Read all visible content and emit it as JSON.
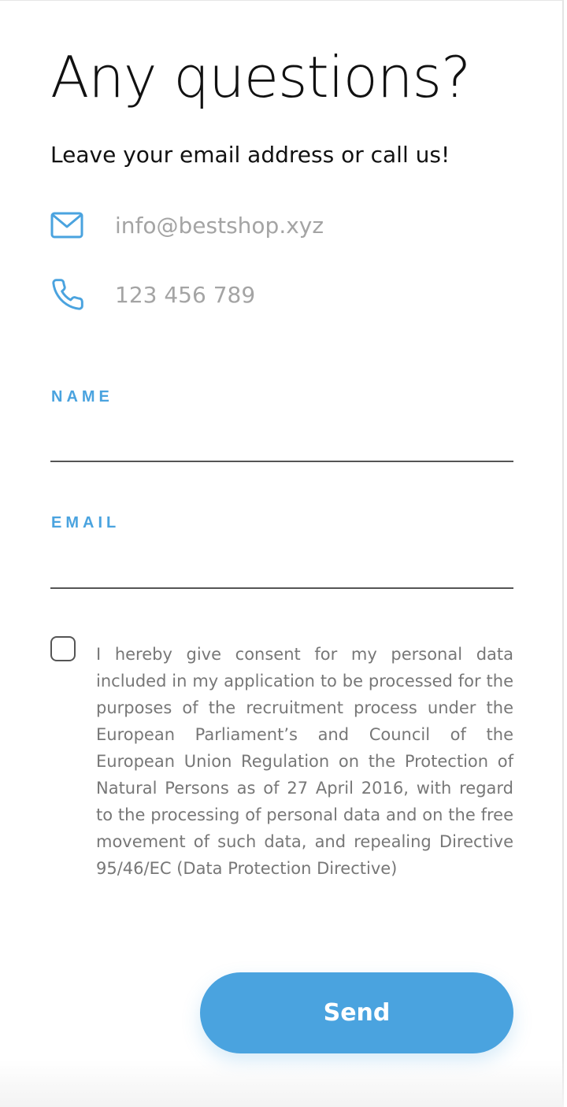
{
  "header": {
    "title": "Any questions?",
    "subtitle": "Leave your email address or call us!"
  },
  "contact": {
    "email": {
      "icon": "mail-icon",
      "value": "info@bestshop.xyz"
    },
    "phone": {
      "icon": "phone-icon",
      "value": "123 456 789"
    }
  },
  "form": {
    "name_label": "NAME",
    "name_value": "",
    "email_label": "EMAIL",
    "email_value": "",
    "consent_checked": false,
    "consent_text": "I hereby give consent for my personal data included in my application to be processed for the purposes of the recruitment process under the European Parliament’s and Council of the European Union Regulation on the Protection of Natural Persons as of 27 April 2016, with regard to the processing of personal data and on the free movement of such data, and repealing Directive 95/46/EC (Data Protection Directive)",
    "send_label": "Send"
  },
  "colors": {
    "accent": "#4aa3df",
    "heading": "#111111",
    "muted_text": "#a4a4a4",
    "body_text": "#777777",
    "line": "#555555"
  }
}
